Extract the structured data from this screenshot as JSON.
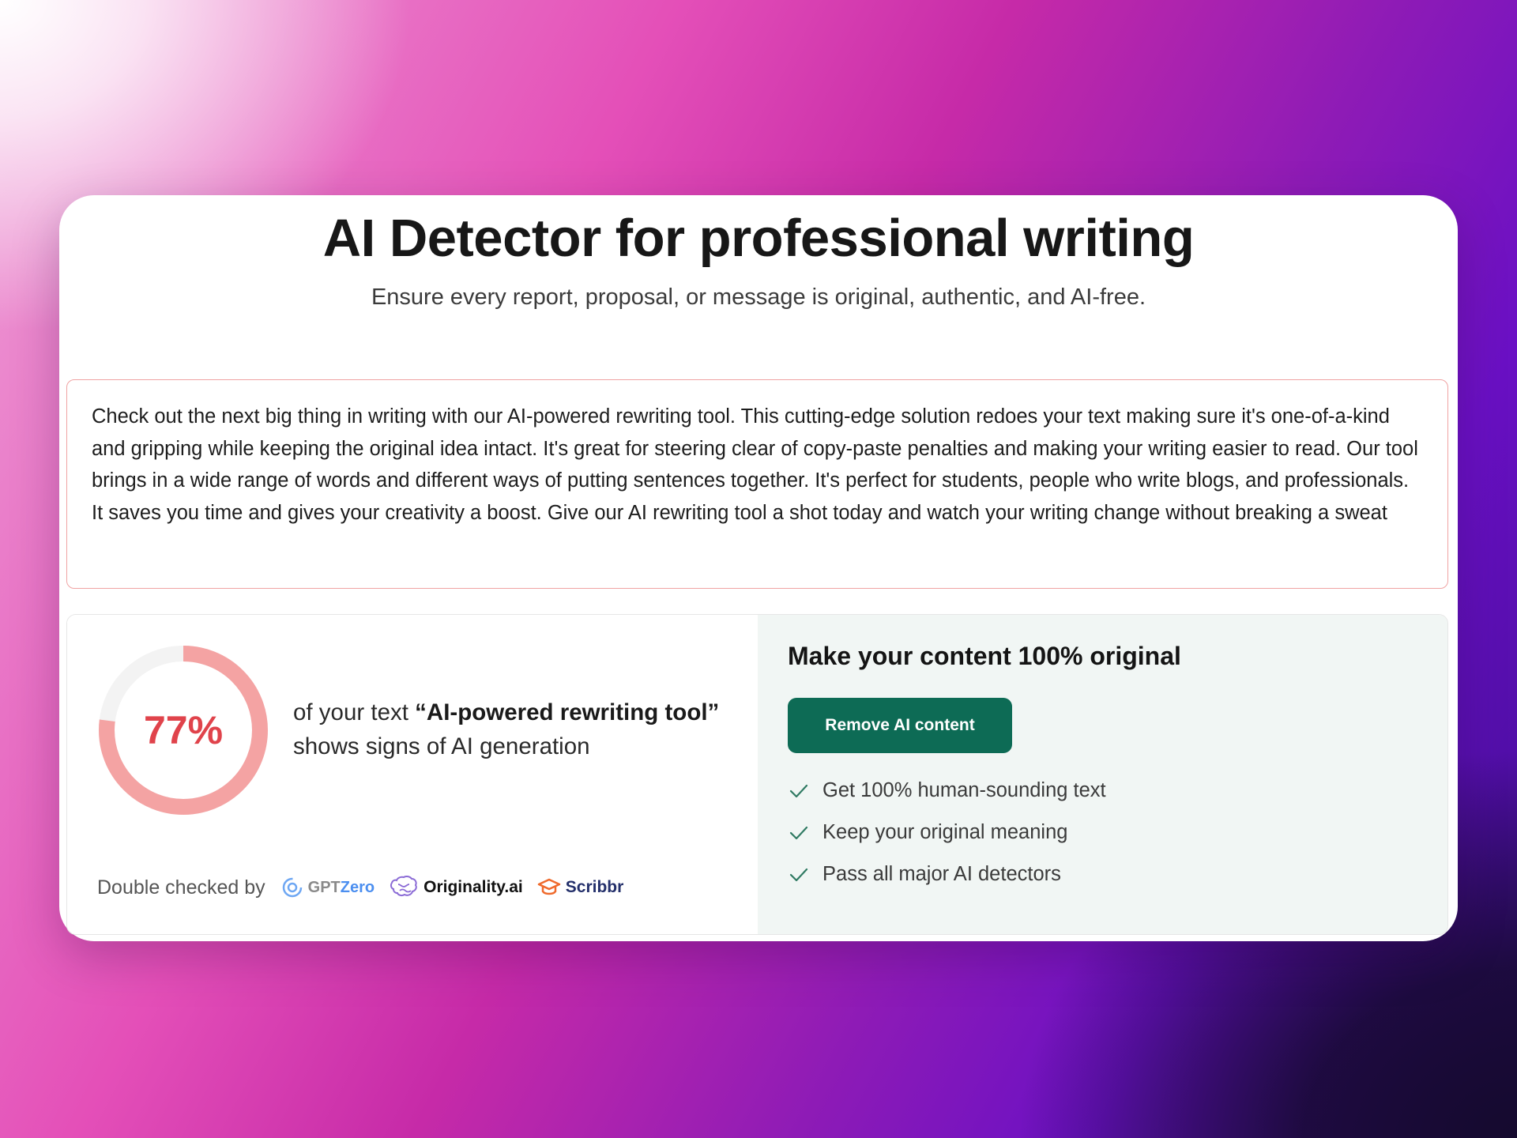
{
  "header": {
    "title": "AI Detector for professional writing",
    "subtitle": "Ensure every report, proposal, or message is original, authentic, and AI-free."
  },
  "input_text": "Check out the next big thing in writing with our AI-powered rewriting tool. This cutting-edge solution redoes your text making sure it's one-of-a-kind and gripping while keeping the original idea intact. It's great for steering clear of copy-paste penalties and making your writing easier to read. Our tool brings in a wide range of words and different ways of putting sentences together. It's perfect for students, people who write blogs, and professionals. It saves you time and gives your creativity a boost. Give our AI rewriting tool a shot today and watch your writing change without breaking a sweat",
  "result": {
    "percent_label": "77%",
    "percent_value": 0.77,
    "text_prefix": "of your text ",
    "quoted_phrase": "“AI-powered rewriting tool”",
    "text_suffix": "shows signs of AI generation",
    "ring_color": "#f4a3a3",
    "ring_track_color": "#f3f3f3",
    "double_checked_label": "Double checked by",
    "brands": {
      "gptzero_prefix": "GPT",
      "gptzero_suffix": "Zero",
      "originality": "Originality.ai",
      "scribbr": "Scribbr"
    }
  },
  "cta": {
    "title": "Make your content 100% original",
    "button_label": "Remove AI content",
    "button_color": "#0d6b55",
    "benefits": [
      "Get 100% human-sounding text",
      "Keep your original meaning",
      "Pass all major AI detectors"
    ]
  }
}
